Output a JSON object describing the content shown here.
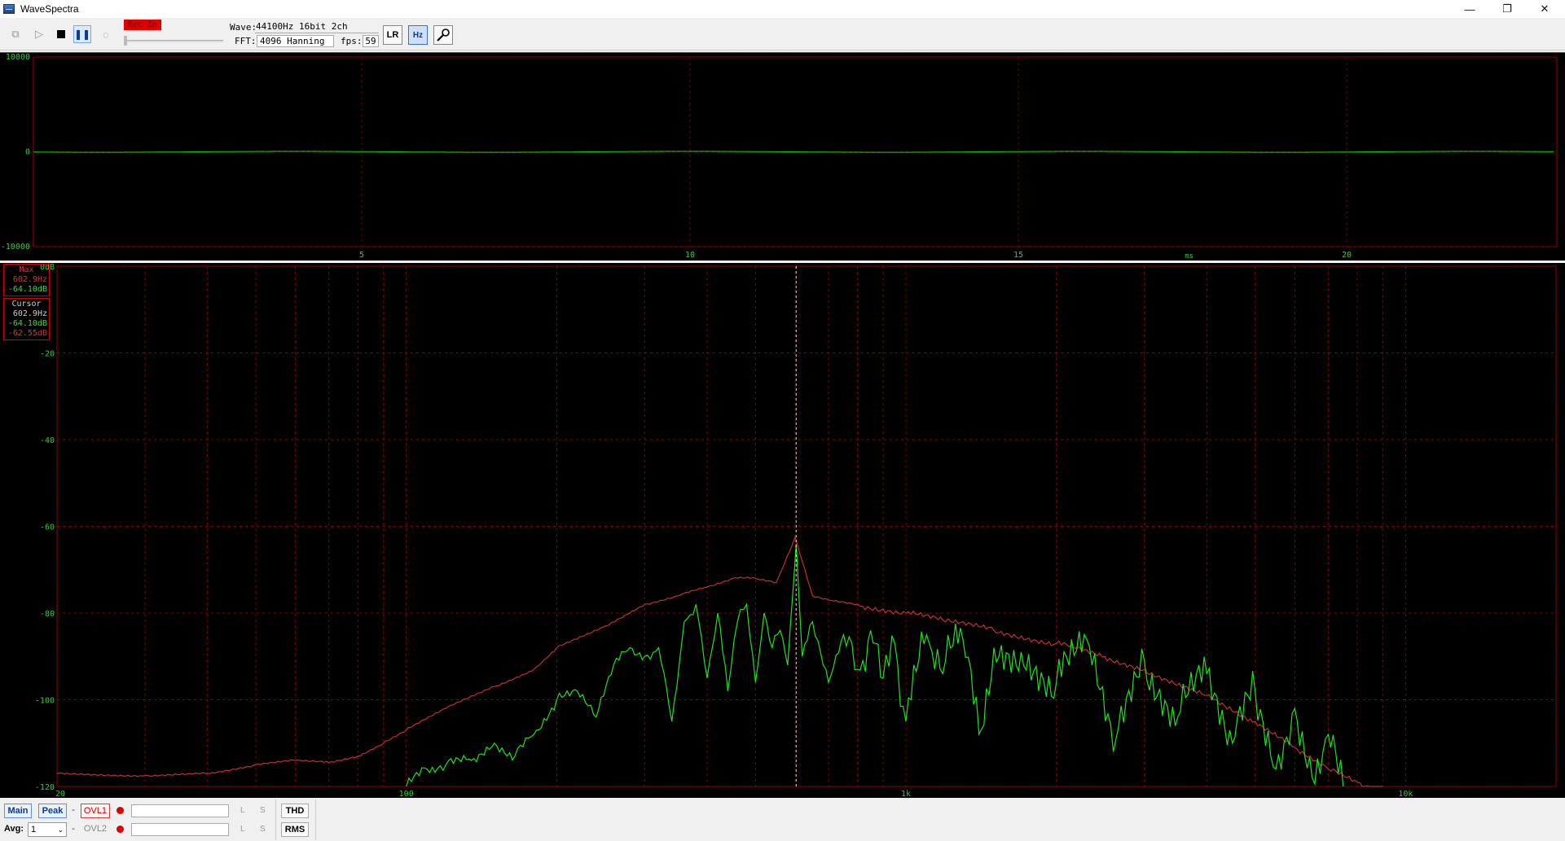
{
  "window": {
    "title": "WaveSpectra",
    "minimize": "—",
    "restore": "❐",
    "close": "✕"
  },
  "toolbar": {
    "rec_label": "Rec In",
    "wave_label": "Wave:",
    "wave_value": "44100Hz 16bit 2ch",
    "fft_label": "FFT:",
    "fft_value": "4096 Hanning",
    "fps_label": "fps:",
    "fps_value": "59",
    "lr_button": "LR",
    "hz_button": "Hz",
    "settings_icon": "wrench-icon"
  },
  "waveform": {
    "y_ticks": [
      "10000",
      "0",
      "-10000"
    ],
    "x_ticks": [
      "5",
      "10",
      "15",
      "20"
    ],
    "x_unit": "ms",
    "trace_color": "#00e000"
  },
  "spectrum": {
    "y_ticks": [
      "0dB",
      "-20",
      "-40",
      "-60",
      "-80",
      "-100",
      "-120"
    ],
    "x_ticks": [
      "20",
      "100",
      "1k",
      "10k"
    ],
    "max_box": {
      "title": "Max",
      "freq": "602.9Hz",
      "level": "-64.10dB"
    },
    "cursor_box": {
      "title": "Cursor",
      "freq": "602.9Hz",
      "level_l": "-64.10dB",
      "level_r": "-62.55dB"
    },
    "grid_color": "#8b0000",
    "peak_trace_color": "#c03030",
    "live_trace_color": "#20e020",
    "cursor_freq_hz": 602.9
  },
  "chart_data": {
    "type": "line",
    "x_scale": "log",
    "xlim": [
      20,
      20000
    ],
    "ylim": [
      -120,
      0
    ],
    "series": [
      {
        "name": "Max",
        "x": [
          20,
          30,
          40,
          50,
          60,
          70,
          80,
          90,
          100,
          120,
          150,
          180,
          200,
          250,
          300,
          350,
          400,
          450,
          500,
          550,
          600,
          650,
          700,
          800,
          1000,
          1200,
          1500,
          2000,
          2500,
          3000,
          4000,
          5000,
          6000,
          7000,
          8000,
          9000
        ],
        "values": [
          -117,
          -117.5,
          -117,
          -115,
          -114,
          -114.5,
          -113,
          -110,
          -107,
          -102,
          -97,
          -93,
          -88,
          -83,
          -78,
          -76,
          -74,
          -72,
          -72,
          -73,
          -62.5,
          -76,
          -77,
          -78,
          -80,
          -82,
          -84,
          -87,
          -90,
          -93,
          -99,
          -105,
          -111,
          -116,
          -119,
          -121
        ]
      },
      {
        "name": "Cursor",
        "x": [
          100,
          110,
          120,
          135,
          150,
          165,
          180,
          200,
          220,
          240,
          260,
          280,
          300,
          320,
          340,
          360,
          380,
          400,
          420,
          440,
          460,
          480,
          500,
          520,
          540,
          560,
          580,
          602.9,
          620,
          650,
          700,
          750,
          800,
          850,
          900,
          950,
          1000,
          1100,
          1200,
          1300,
          1400,
          1500,
          1700,
          2000,
          2300,
          2600,
          3000,
          3500,
          4000,
          4500,
          5000,
          5500,
          6000,
          6500,
          7000,
          7500
        ],
        "values": [
          -120,
          -116,
          -115,
          -114,
          -110,
          -113,
          -108,
          -100,
          -98,
          -104,
          -92,
          -88,
          -90,
          -88,
          -105,
          -82,
          -78,
          -95,
          -80,
          -98,
          -82,
          -78,
          -96,
          -80,
          -88,
          -84,
          -92,
          -64.1,
          -90,
          -82,
          -96,
          -85,
          -93,
          -84,
          -95,
          -87,
          -105,
          -85,
          -91,
          -86,
          -108,
          -88,
          -89,
          -96,
          -86,
          -112,
          -91,
          -104,
          -94,
          -110,
          -98,
          -116,
          -102,
          -118,
          -108,
          -120
        ]
      }
    ]
  }
}
